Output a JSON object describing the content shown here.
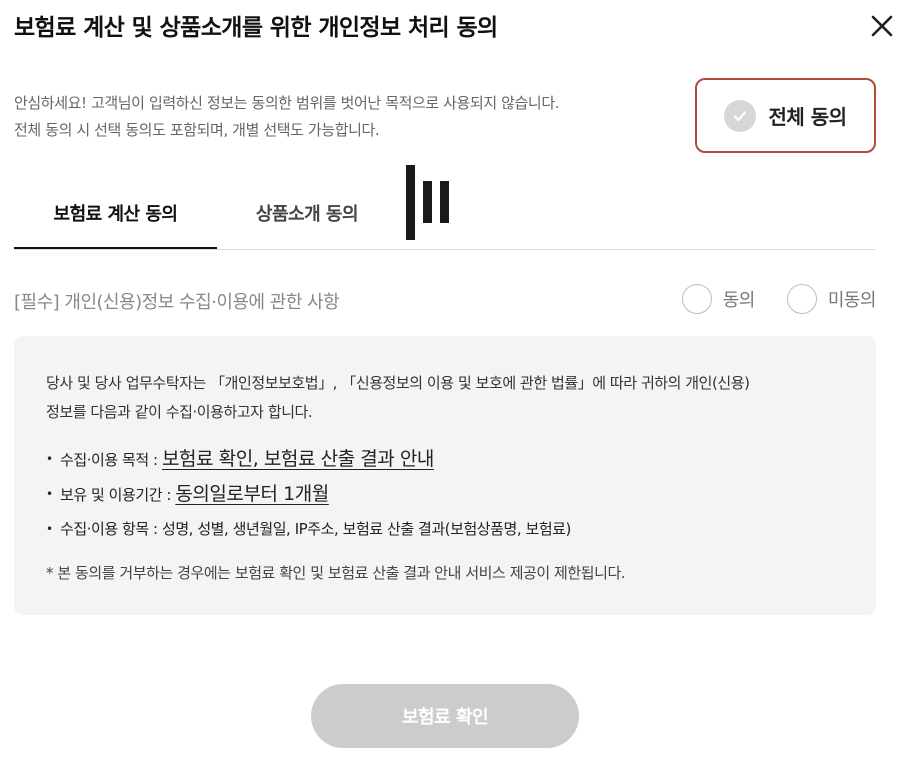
{
  "dialog": {
    "title": "보험료 계산 및 상품소개를 위한 개인정보 처리 동의"
  },
  "intro": {
    "line1": "안심하세요! 고객님이 입력하신 정보는 동의한 범위를 벗어난 목적으로 사용되지 않습니다.",
    "line2": "전체 동의 시 선택 동의도 포함되며, 개별 선택도 가능합니다."
  },
  "agree_all": {
    "label": "전체 동의",
    "checked": false
  },
  "tabs": [
    {
      "label": "보험료 계산 동의",
      "active": true
    },
    {
      "label": "상품소개 동의",
      "active": false
    }
  ],
  "section": {
    "title": "[필수] 개인(신용)정보 수집·이용에 관한 사항",
    "options": [
      {
        "label": "동의",
        "selected": false
      },
      {
        "label": "미동의",
        "selected": false
      }
    ]
  },
  "details": {
    "notice_line1": "당사 및 당사 업무수탁자는 「개인정보보호법」, 「신용정보의 이용 및 보호에 관한 법률」에 따라 귀하의 개인(신용)",
    "notice_line2": "정보를 다음과 같이 수집·이용하고자 합니다.",
    "items": [
      {
        "label": "수집·이용 목적 : ",
        "value": "보험료 확인, 보험료 산출 결과 안내"
      },
      {
        "label": "보유 및 이용기간 : ",
        "value": "동의일로부터 1개월"
      },
      {
        "label": "수집·이용 항목 : ",
        "value": "성명, 성별, 생년월일, IP주소, 보험료 산출 결과(보험상품명, 보험료)"
      }
    ],
    "footnote": "* 본 동의를 거부하는 경우에는 보험료 확인 및 보험료 산출 결과 안내 서비스 제공이 제한됩니다."
  },
  "confirm": {
    "label": "보험료 확인",
    "enabled": false
  },
  "colors": {
    "accent_border": "#b04a3a",
    "disabled_button": "#cccccc",
    "panel_bg": "#f4f4f4"
  }
}
